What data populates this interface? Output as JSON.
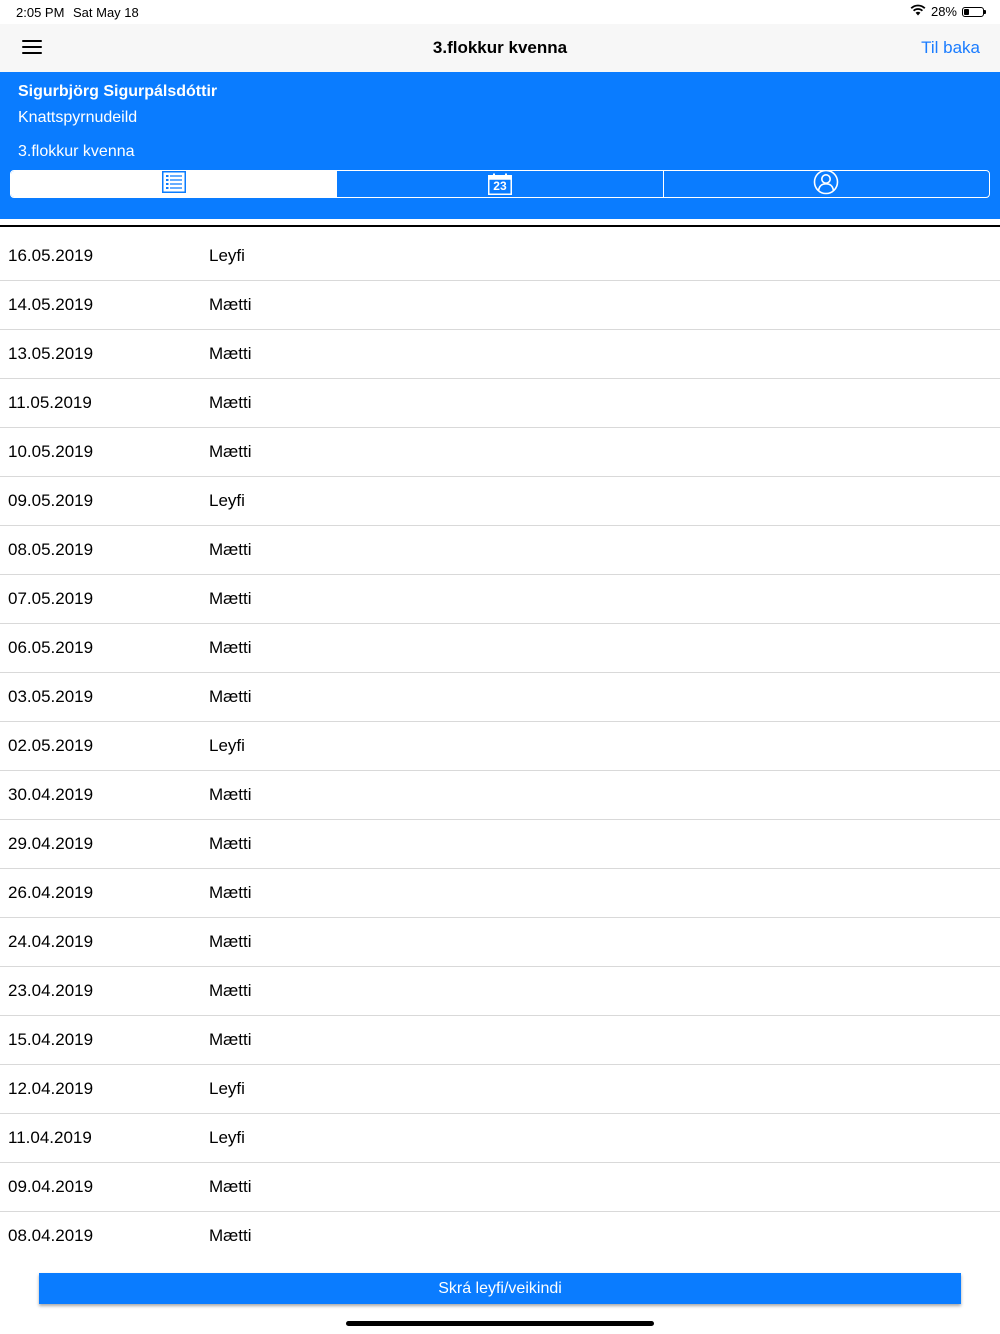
{
  "status_bar": {
    "time": "2:05 PM",
    "date": "Sat May 18",
    "battery": "28%",
    "battery_level": 0.28
  },
  "nav": {
    "title": "3.flokkur kvenna",
    "back_label": "Til baka"
  },
  "header": {
    "name": "Sigurbjörg Sigurpálsdóttir",
    "department": "Knattspyrnudeild",
    "group": "3.flokkur kvenna",
    "calendar_day": "23",
    "segments": [
      {
        "icon": "list-icon",
        "active": true
      },
      {
        "icon": "calendar-icon",
        "active": false
      },
      {
        "icon": "user-profile-icon",
        "active": false
      }
    ]
  },
  "attendance": [
    {
      "date": "16.05.2019",
      "status": "Leyfi"
    },
    {
      "date": "14.05.2019",
      "status": "Mætti"
    },
    {
      "date": "13.05.2019",
      "status": "Mætti"
    },
    {
      "date": "11.05.2019",
      "status": "Mætti"
    },
    {
      "date": "10.05.2019",
      "status": "Mætti"
    },
    {
      "date": "09.05.2019",
      "status": "Leyfi"
    },
    {
      "date": "08.05.2019",
      "status": "Mætti"
    },
    {
      "date": "07.05.2019",
      "status": "Mætti"
    },
    {
      "date": "06.05.2019",
      "status": "Mætti"
    },
    {
      "date": "03.05.2019",
      "status": "Mætti"
    },
    {
      "date": "02.05.2019",
      "status": "Leyfi"
    },
    {
      "date": "30.04.2019",
      "status": "Mætti"
    },
    {
      "date": "29.04.2019",
      "status": "Mætti"
    },
    {
      "date": "26.04.2019",
      "status": "Mætti"
    },
    {
      "date": "24.04.2019",
      "status": "Mætti"
    },
    {
      "date": "23.04.2019",
      "status": "Mætti"
    },
    {
      "date": "15.04.2019",
      "status": "Mætti"
    },
    {
      "date": "12.04.2019",
      "status": "Leyfi"
    },
    {
      "date": "11.04.2019",
      "status": "Leyfi"
    },
    {
      "date": "09.04.2019",
      "status": "Mætti"
    },
    {
      "date": "08.04.2019",
      "status": "Mætti"
    }
  ],
  "action_button": {
    "label": "Skrá leyfi/veikindi"
  },
  "colors": {
    "accent": "#0a7cff",
    "link": "#1a7cff",
    "nav_bg": "#f7f7f7"
  }
}
